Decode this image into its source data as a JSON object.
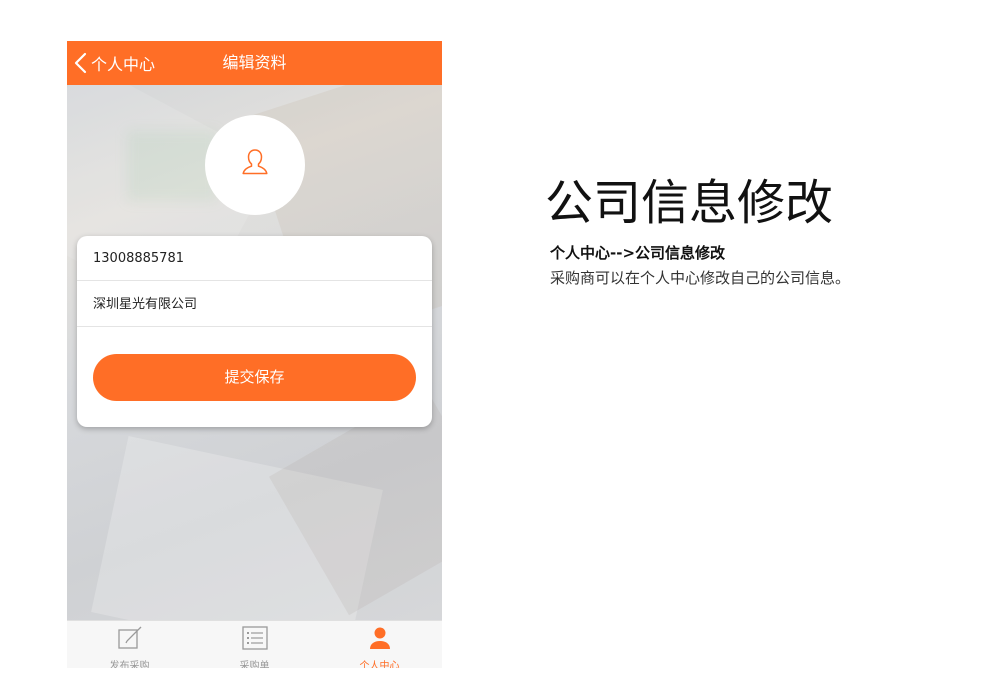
{
  "phone": {
    "header": {
      "back_label": "个人中心",
      "title": "编辑资料"
    },
    "avatar": {
      "icon": "user-outline-icon"
    },
    "form": {
      "phone_value": "13008885781",
      "company_value": "深圳星光有限公司",
      "submit_label": "提交保存"
    },
    "tabbar": {
      "tabs": [
        {
          "label": "发布采购",
          "icon": "edit-icon",
          "active": false
        },
        {
          "label": "采购单",
          "icon": "list-icon",
          "active": false
        },
        {
          "label": "个人中心",
          "icon": "user-filled-icon",
          "active": true
        }
      ]
    }
  },
  "description": {
    "title": "公司信息修改",
    "subtitle": "个人中心-->公司信息修改",
    "text": "采购商可以在个人中心修改自己的公司信息。"
  },
  "colors": {
    "accent": "#ff6e26",
    "tab_inactive": "#999999"
  }
}
